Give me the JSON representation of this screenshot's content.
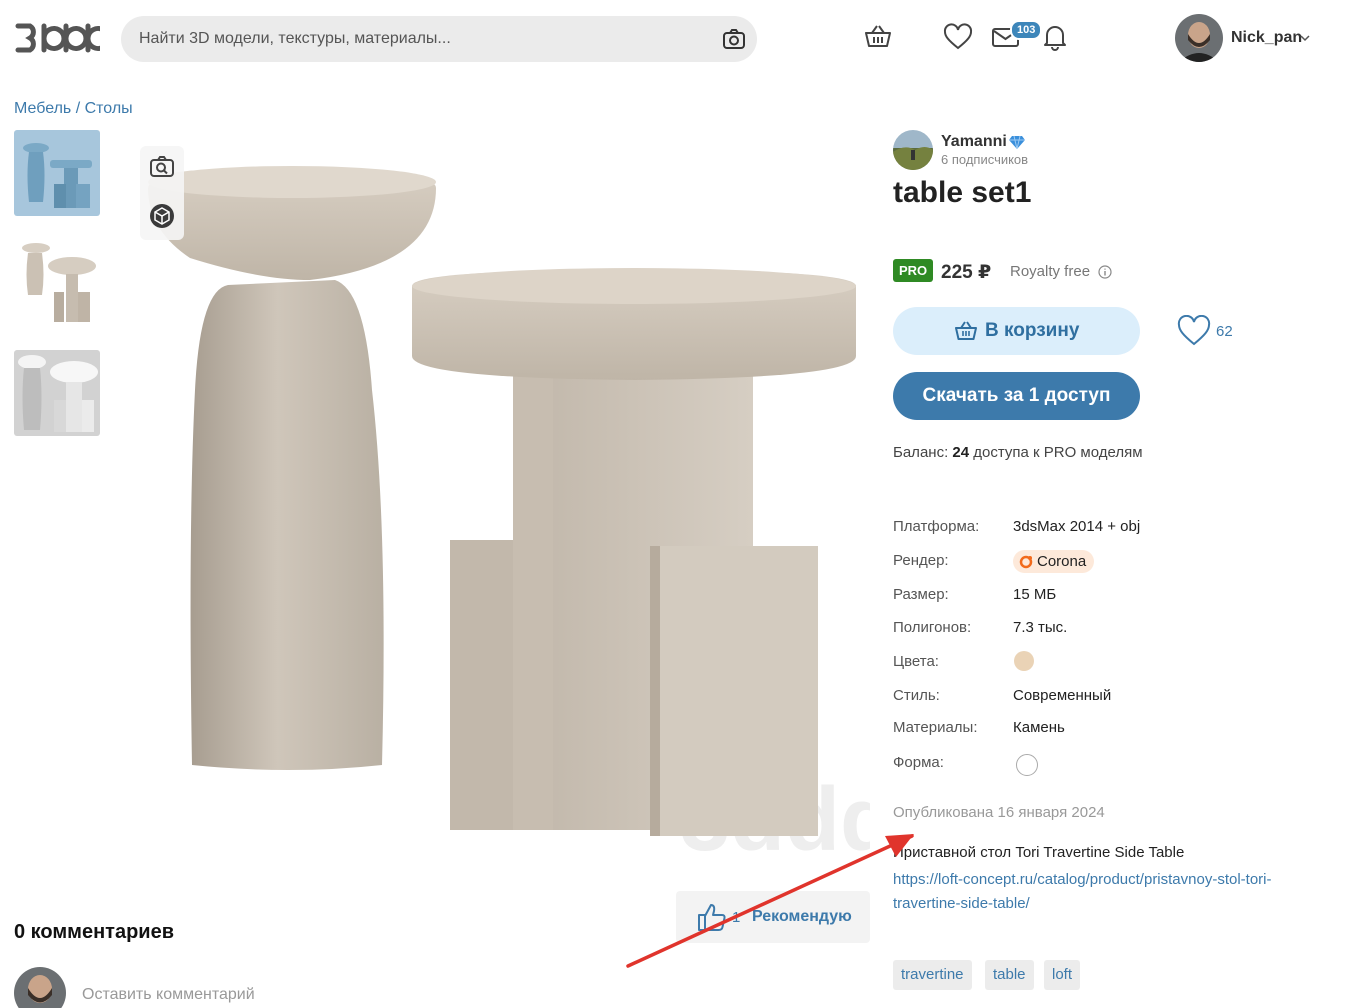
{
  "header": {
    "logo_text": "3ddd",
    "search_placeholder": "Найти 3D модели, текстуры, материалы...",
    "messages_badge": "103",
    "username": "Nick_pan"
  },
  "breadcrumb": {
    "category": "Мебель",
    "separator": " / ",
    "subcategory": "Столы"
  },
  "model": {
    "author_name": "Yamanni",
    "author_subscribers": "6 подписчиков",
    "title": "table set1",
    "pro_badge": "PRO",
    "price": "225 ₽",
    "license": "Royalty free",
    "cart_button": "В корзину",
    "favorites_count": "62",
    "download_button": "Скачать за 1 доступ",
    "balance_prefix": "Баланс: ",
    "balance_count": "24",
    "balance_suffix": " доступа к PRO моделям",
    "color_swatch": "#ead3b6"
  },
  "specs": [
    {
      "label": "Платформа:",
      "value": "3dsMax 2014 + obj"
    },
    {
      "label": "Рендер:",
      "value": "Corona"
    },
    {
      "label": "Размер:",
      "value": "15 МБ"
    },
    {
      "label": "Полигонов:",
      "value": "7.3 тыс."
    },
    {
      "label": "Цвета:",
      "value": ""
    },
    {
      "label": "Стиль:",
      "value": "Современный"
    },
    {
      "label": "Материалы:",
      "value": "Камень"
    },
    {
      "label": "Форма:",
      "value": ""
    }
  ],
  "published": "Опубликована 16 января 2024",
  "description": "Приставной стол Tori Travertine Side Table",
  "description_link": "https://loft-concept.ru/catalog/product/pristavnoy-stol-tori-travertine-side-table/",
  "tags": [
    "travertine",
    "table",
    "loft"
  ],
  "recommend": {
    "count": "1",
    "label": "Рекомендую"
  },
  "comments": {
    "title": "0 комментариев",
    "placeholder": "Оставить комментарий"
  },
  "colors": {
    "accent": "#3d7aab",
    "pro_green": "#2f8a24",
    "annotation_arrow": "#e0342c"
  }
}
